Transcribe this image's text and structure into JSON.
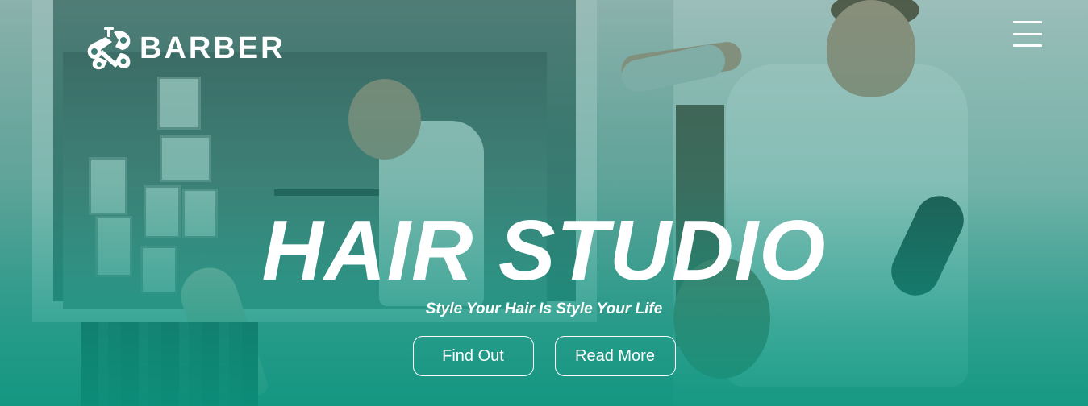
{
  "header": {
    "logo_text": "BARBER",
    "logo_icon": "scissors-comb-logo-icon",
    "menu_icon": "hamburger-menu-icon"
  },
  "hero": {
    "title": "HAIR STUDIO",
    "subtitle": "Style Your Hair Is Style Your Life",
    "buttons": [
      {
        "label": "Find Out"
      },
      {
        "label": "Read More"
      }
    ]
  },
  "colors": {
    "overlay_accent": "#0f9682",
    "text": "#ffffff"
  }
}
